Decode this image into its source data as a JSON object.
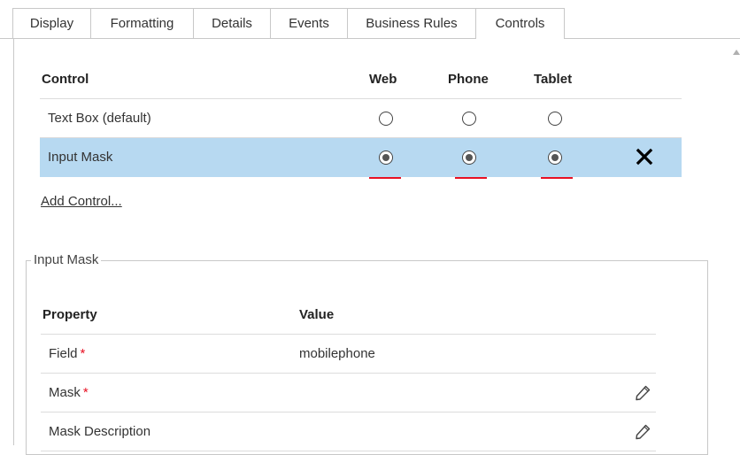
{
  "tabs": [
    {
      "label": "Display"
    },
    {
      "label": "Formatting"
    },
    {
      "label": "Details"
    },
    {
      "label": "Events"
    },
    {
      "label": "Business Rules"
    },
    {
      "label": "Controls",
      "active": true
    }
  ],
  "controls_table": {
    "headers": {
      "control": "Control",
      "web": "Web",
      "phone": "Phone",
      "tablet": "Tablet"
    },
    "rows": [
      {
        "label": "Text Box (default)",
        "web": false,
        "phone": false,
        "tablet": false,
        "selected_row": false
      },
      {
        "label": "Input Mask",
        "web": true,
        "phone": true,
        "tablet": true,
        "selected_row": true
      }
    ],
    "add_link": "Add Control..."
  },
  "input_mask": {
    "legend": "Input Mask",
    "headers": {
      "property": "Property",
      "value": "Value"
    },
    "rows": [
      {
        "property": "Field",
        "required": true,
        "value": "mobilephone",
        "icon": "pencil-icon",
        "editable": false
      },
      {
        "property": "Mask",
        "required": true,
        "value": "",
        "icon": "pencil-icon",
        "editable": true
      },
      {
        "property": "Mask Description",
        "required": false,
        "value": "",
        "icon": "pencil-icon",
        "editable": true
      }
    ]
  },
  "colors": {
    "selected_row": "#b7d9f1",
    "required_asterisk": "#e81123",
    "underline": "#e81123"
  }
}
